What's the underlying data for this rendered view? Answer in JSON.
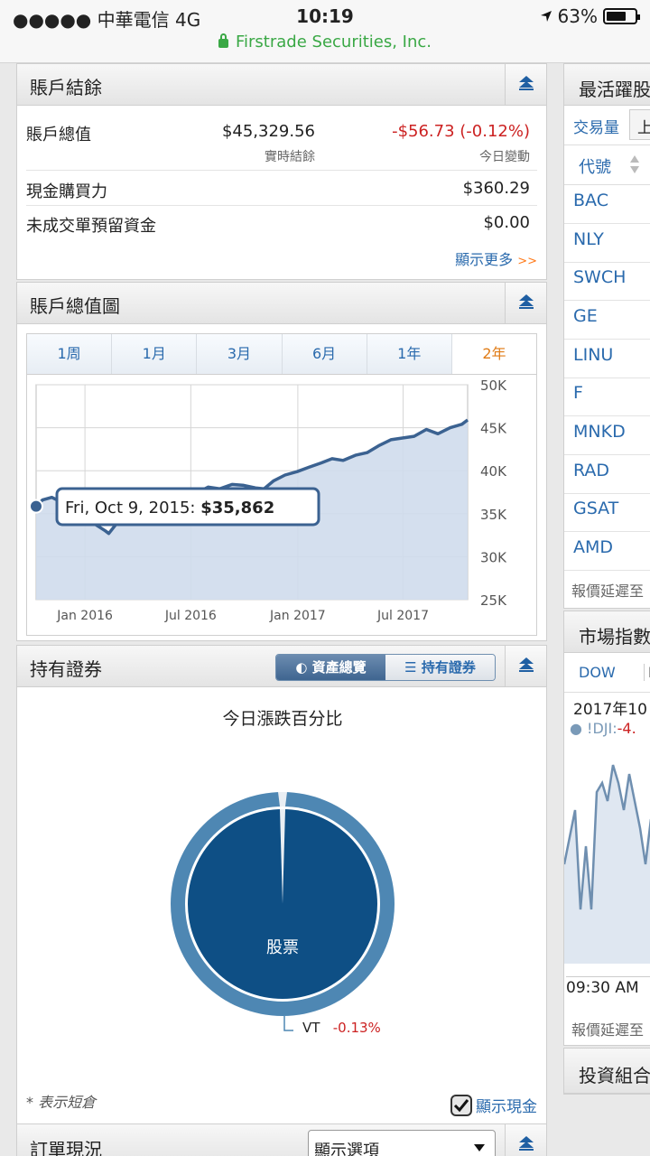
{
  "status_bar": {
    "carrier": "●●●●● 中華電信  4G",
    "time": "10:19",
    "battery": "63%",
    "url": "Firstrade Securities, Inc."
  },
  "account_balance": {
    "title": "賬戶結餘",
    "total_value_label": "賬戶總值",
    "total_value": "$45,329.56",
    "realtime_label": "實時結餘",
    "change": "-$56.73 (-0.12%)",
    "change_label": "今日變動",
    "cash_label": "現金購買力",
    "cash_value": "$360.29",
    "pending_label": "未成交單預留資金",
    "pending_value": "$0.00",
    "more_label": "顯示更多",
    "more_arrow": ">>"
  },
  "value_chart": {
    "title": "賬戶總值圖",
    "tabs": [
      "1周",
      "1月",
      "3月",
      "6月",
      "1年",
      "2年"
    ],
    "active_tab": "2年",
    "tooltip_date": "Fri, Oct 9, 2015:",
    "tooltip_value": "$35,862"
  },
  "chart_data": {
    "type": "area",
    "x_ticks": [
      "Jan 2016",
      "Jul 2016",
      "Jan 2017",
      "Jul 2017"
    ],
    "y_ticks": [
      "50K",
      "45K",
      "40K",
      "35K",
      "30K",
      "25K"
    ],
    "ylim": [
      25000,
      50000
    ],
    "grid": true,
    "x": [
      "2015-10-09",
      "2015-10-20",
      "2015-11-05",
      "2015-11-20",
      "2015-12-05",
      "2015-12-20",
      "2016-01-05",
      "2016-01-20",
      "2016-02-05",
      "2016-02-11",
      "2016-02-25",
      "2016-03-10",
      "2016-03-31",
      "2016-04-20",
      "2016-05-10",
      "2016-06-01",
      "2016-06-24",
      "2016-07-10",
      "2016-07-31",
      "2016-08-20",
      "2016-09-10",
      "2016-09-30",
      "2016-10-20",
      "2016-11-04",
      "2016-11-20",
      "2016-12-10",
      "2016-12-31",
      "2017-01-20",
      "2017-02-10",
      "2017-03-01",
      "2017-03-20",
      "2017-04-10",
      "2017-04-30",
      "2017-05-20",
      "2017-06-10",
      "2017-06-30",
      "2017-07-20",
      "2017-08-10",
      "2017-08-30",
      "2017-09-20",
      "2017-10-10",
      "2017-10-20"
    ],
    "values": [
      35862,
      36600,
      36900,
      36400,
      36100,
      35600,
      34300,
      33700,
      33000,
      32700,
      33900,
      34700,
      35300,
      35600,
      35900,
      36400,
      35600,
      37400,
      38100,
      37900,
      38400,
      38300,
      38000,
      37900,
      38800,
      39500,
      39900,
      40400,
      40900,
      41400,
      41200,
      41800,
      42100,
      42900,
      43600,
      43800,
      44000,
      44800,
      44300,
      45000,
      45400,
      45900
    ]
  },
  "holdings": {
    "title": "持有證券",
    "toggle_overview": "資產總覽",
    "toggle_holdings": "持有證券",
    "pie_title": "今日漲跌百分比",
    "slice_label": "股票",
    "callout_symbol": "VT",
    "callout_change": "-0.13%",
    "short_note": "* 表示短倉",
    "show_cash": "顯示現金",
    "colors": {
      "outer": "#4e87b3",
      "inner": "#0e4f85"
    }
  },
  "orders": {
    "title": "訂單現況",
    "select_value": "顯示選項"
  },
  "most_active": {
    "title": "最活躍股",
    "tab_volume": "交易量",
    "tab_up": "上",
    "col_symbol": "代號",
    "symbols": [
      "BAC",
      "NLY",
      "SWCH",
      "GE",
      "LINU",
      "F",
      "MNKD",
      "RAD",
      "GSAT",
      "AMD"
    ],
    "delay_note": "報價延遲至"
  },
  "market_index": {
    "title": "市場指數",
    "tab_dow": "DOW",
    "tab_next": "N",
    "date": "2017年10",
    "index_symbol": "!DJI:",
    "index_change": "-4.",
    "time_label": "09:30 AM",
    "delay_note": "報價延遲至"
  },
  "portfolio": {
    "title": "投資組合"
  }
}
